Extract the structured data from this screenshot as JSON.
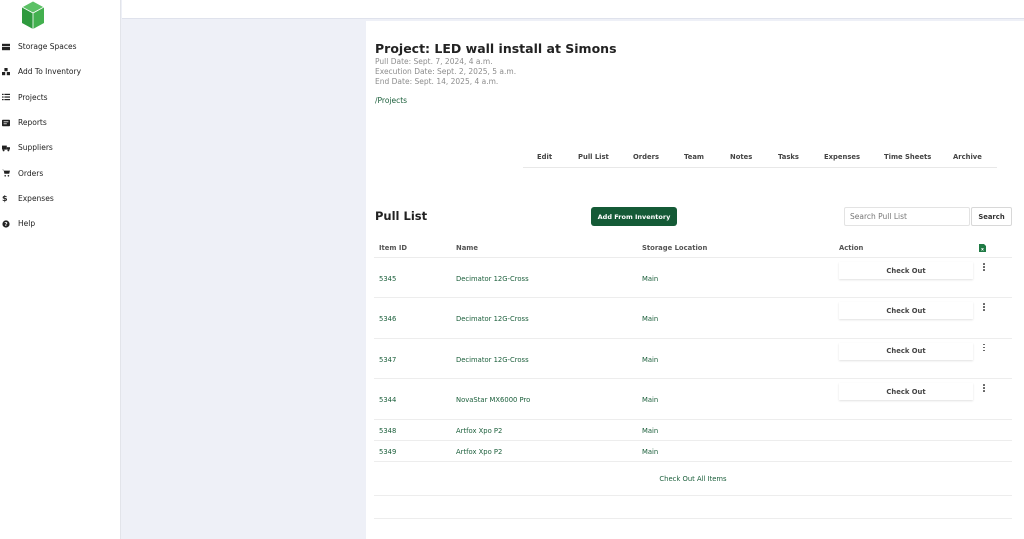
{
  "sidebar": {
    "items": [
      {
        "label": "Storage Spaces",
        "icon": "storage-icon"
      },
      {
        "label": "Add To Inventory",
        "icon": "boxes-icon"
      },
      {
        "label": "Projects",
        "icon": "list-icon"
      },
      {
        "label": "Reports",
        "icon": "report-icon"
      },
      {
        "label": "Suppliers",
        "icon": "truck-icon"
      },
      {
        "label": "Orders",
        "icon": "cart-icon"
      },
      {
        "label": "Expenses",
        "icon": "dollar-icon"
      },
      {
        "label": "Help",
        "icon": "help-icon"
      }
    ]
  },
  "project": {
    "title": "Project: LED wall install at Simons",
    "pull_date": "Pull Date: Sept. 7, 2024, 4 a.m.",
    "execution_date": "Execution Date: Sept. 2, 2025, 5 a.m.",
    "end_date": "End Date: Sept. 14, 2025, 4 a.m.",
    "breadcrumb": "/Projects"
  },
  "tabs": [
    "Edit",
    "Pull List",
    "Orders",
    "Team",
    "Notes",
    "Tasks",
    "Expenses",
    "Time Sheets",
    "Archive"
  ],
  "pull_list": {
    "title": "Pull List",
    "add_button": "Add From Inventory",
    "search_placeholder": "Search Pull List",
    "search_button": "Search",
    "columns": [
      "Item ID",
      "Name",
      "Storage Location",
      "Action"
    ],
    "rows": [
      {
        "id": "5345",
        "name": "Decimator 12G-Cross",
        "location": "Main",
        "action": "Check Out"
      },
      {
        "id": "5346",
        "name": "Decimator 12G-Cross",
        "location": "Main",
        "action": "Check Out"
      },
      {
        "id": "5347",
        "name": "Decimator 12G-Cross",
        "location": "Main",
        "action": "Check Out"
      },
      {
        "id": "5344",
        "name": "NovaStar MX6000 Pro",
        "location": "Main",
        "action": "Check Out"
      },
      {
        "id": "5348",
        "name": "Artfox Xpo P2",
        "location": "Main",
        "action": ""
      },
      {
        "id": "5349",
        "name": "Artfox Xpo P2",
        "location": "Main",
        "action": ""
      }
    ],
    "checkout_all": "Check Out All Items"
  },
  "colors": {
    "accent": "#145a36",
    "link": "#1a5e3a",
    "background": "#eef0f7",
    "logo": "#3aa84a"
  }
}
